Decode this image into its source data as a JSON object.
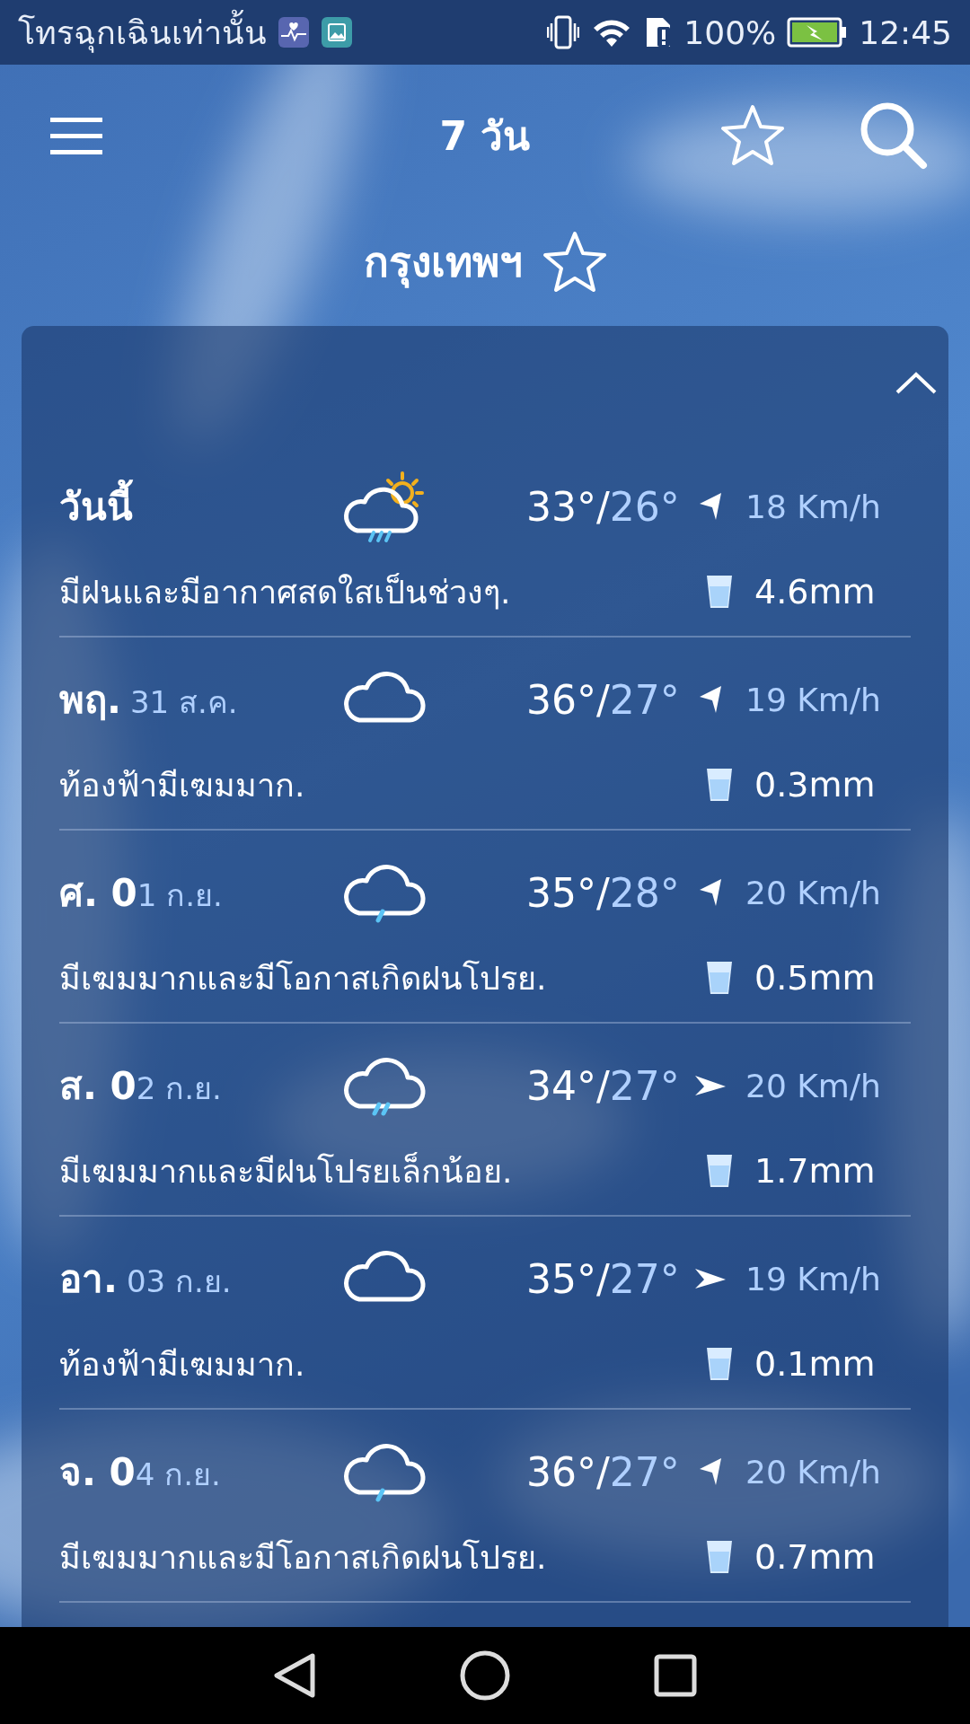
{
  "status_bar": {
    "carrier": "โทรฉุกเฉินเท่านั้น",
    "battery": "100%",
    "time": "12:45"
  },
  "toolbar": {
    "title": "7 วัน"
  },
  "city": {
    "name": "กรุงเทพฯ"
  },
  "forecast": [
    {
      "day": "วันนี้",
      "kind": "sun-rain",
      "high": "33°/",
      "low": "26°",
      "wind": {
        "kind": "nw",
        "speed": "18 Km/h"
      },
      "description": "มีฝนและมีอากาศสดใสเป็นช่วงๆ.",
      "rain": "4.6mm"
    },
    {
      "day": "พฤ.",
      "date": "31 ส.ค.",
      "kind": "cloud",
      "high": "36°/",
      "low": "27°",
      "wind": {
        "kind": "nw",
        "speed": "19 Km/h"
      },
      "description": "ท้องฟ้ามีเฆมมาก.",
      "rain": "0.3mm"
    },
    {
      "day": "ศ. 0",
      "date": "1 ก.ย.",
      "kind": "light-rain",
      "high": "35°/",
      "low": "28°",
      "wind": {
        "kind": "nw",
        "speed": "20 Km/h"
      },
      "description": "มีเฆมมากและมีโอกาสเกิดฝนโปรย.",
      "rain": "0.5mm"
    },
    {
      "day": "ส. 0",
      "date": "2 ก.ย.",
      "kind": "rain",
      "high": "34°/",
      "low": "27°",
      "wind": {
        "kind": "e",
        "speed": "20 Km/h"
      },
      "description": "มีเฆมมากและมีฝนโปรยเล็กน้อย.",
      "rain": "1.7mm"
    },
    {
      "day": "อา.",
      "date": "03 ก.ย.",
      "kind": "cloud",
      "high": "35°/",
      "low": "27°",
      "wind": {
        "kind": "e",
        "speed": "19 Km/h"
      },
      "description": "ท้องฟ้ามีเฆมมาก.",
      "rain": "0.1mm"
    },
    {
      "day": "จ. 0",
      "date": "4 ก.ย.",
      "kind": "light-rain",
      "high": "36°/",
      "low": "27°",
      "wind": {
        "kind": "nw",
        "speed": "20 Km/h"
      },
      "description": "มีเฆมมากและมีโอกาสเกิดฝนโปรย.",
      "rain": "0.7mm"
    }
  ]
}
